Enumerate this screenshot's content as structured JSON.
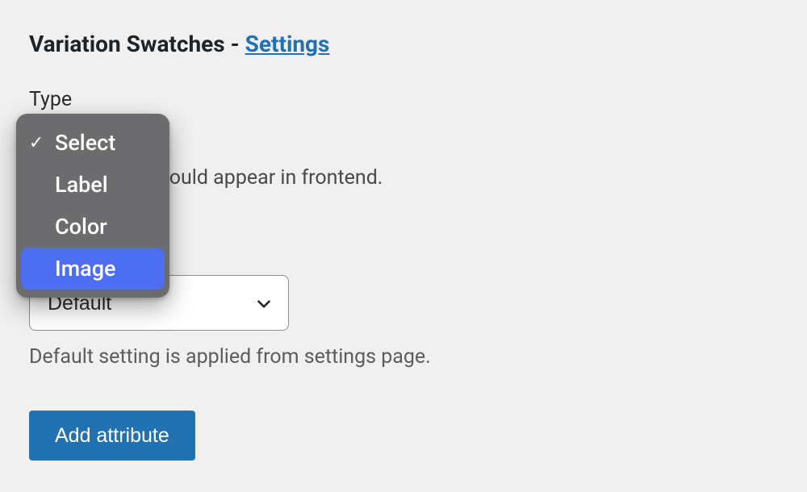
{
  "heading": {
    "prefix": "Variation Swatches - ",
    "link_label": "Settings"
  },
  "type_field": {
    "label": "Type",
    "help": "this attribute should appear in frontend.",
    "options": [
      "Select",
      "Label",
      "Color",
      "Image"
    ],
    "selected": "Select",
    "highlighted": "Image"
  },
  "shape_field": {
    "value": "Default",
    "help": "Default setting is applied from settings page."
  },
  "add_button_label": "Add attribute",
  "icons": {
    "checkmark": "✓"
  }
}
